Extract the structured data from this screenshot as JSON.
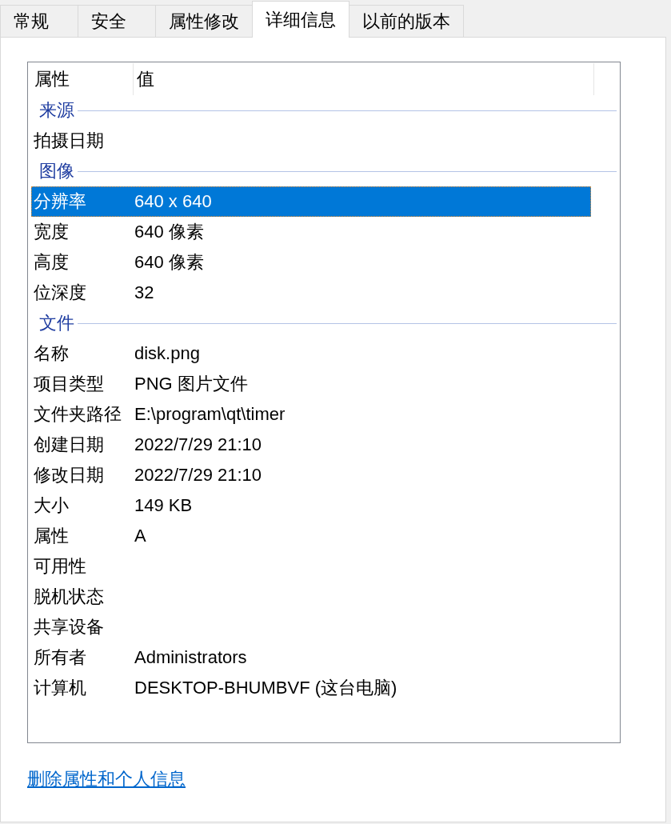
{
  "tabs": [
    {
      "label": "常规",
      "selected": false
    },
    {
      "label": "安全",
      "selected": false
    },
    {
      "label": "属性修改",
      "selected": false
    },
    {
      "label": "详细信息",
      "selected": true
    },
    {
      "label": "以前的版本",
      "selected": false
    }
  ],
  "table": {
    "columns": [
      "属性",
      "值"
    ],
    "groups": [
      {
        "title": "来源",
        "rows": [
          {
            "name": "拍摄日期",
            "selected": false
          }
        ]
      },
      {
        "title": "图像",
        "rows": [
          {
            "name": "分辨率",
            "value": "640 x 640",
            "selected": true
          },
          {
            "name": "宽度",
            "value": "640 像素",
            "selected": false
          },
          {
            "name": "高度",
            "value": "640 像素",
            "selected": false
          },
          {
            "name": "位深度",
            "value": "32",
            "selected": false
          }
        ]
      },
      {
        "title": "文件",
        "rows": [
          {
            "name": "名称",
            "value": "disk.png",
            "selected": false
          },
          {
            "name": "项目类型",
            "value": "PNG 图片文件",
            "selected": false
          },
          {
            "name": "文件夹路径",
            "value": "E:\\program\\qt\\timer",
            "selected": false
          },
          {
            "name": "创建日期",
            "value": "2022/7/29 21:10",
            "selected": false
          },
          {
            "name": "修改日期",
            "value": "2022/7/29 21:10",
            "selected": false
          },
          {
            "name": "大小",
            "value": "149 KB",
            "selected": false
          },
          {
            "name": "属性",
            "value": "A",
            "selected": false
          },
          {
            "name": "可用性",
            "selected": false
          },
          {
            "name": "脱机状态",
            "selected": false
          },
          {
            "name": "共享设备",
            "selected": false
          },
          {
            "name": "所有者",
            "value": "Administrators",
            "selected": false
          },
          {
            "name": "计算机",
            "value": "DESKTOP-BHUMBVF (这台电脑)",
            "selected": false
          }
        ]
      }
    ]
  },
  "link": "删除属性和个人信息"
}
